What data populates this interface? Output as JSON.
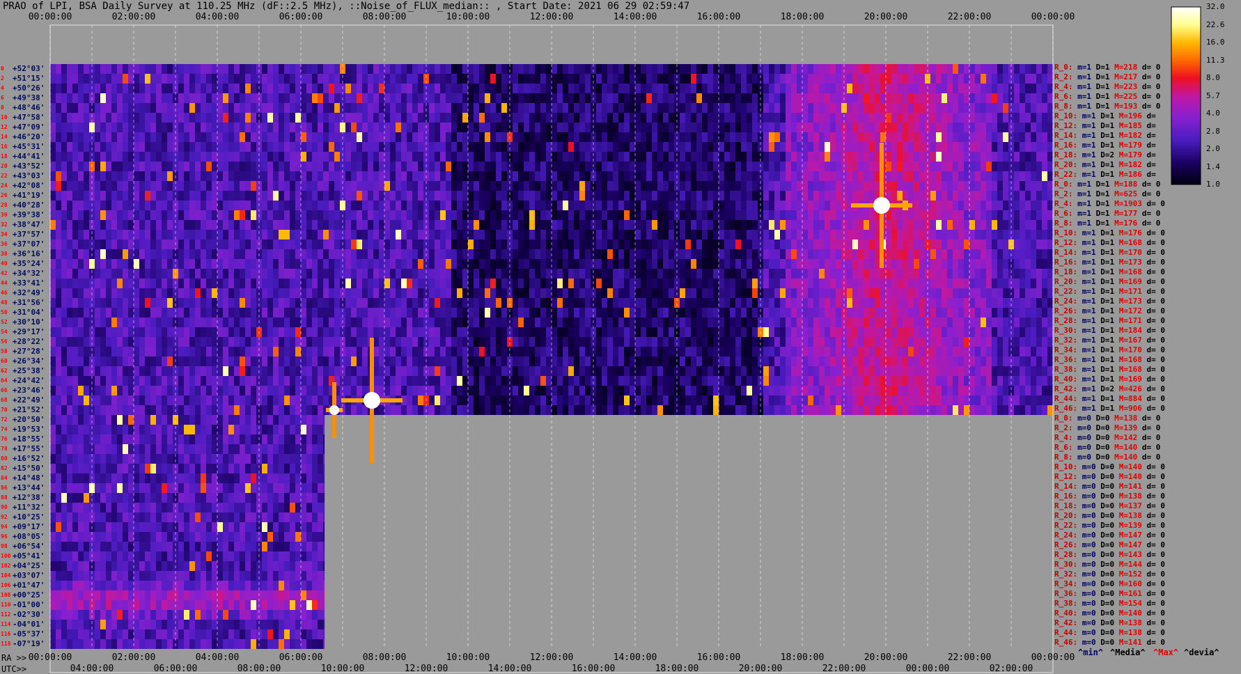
{
  "title": "PRAO of LPI, BSA Daily Survey at 110.25 MHz (dF::2.5 MHz), ::Noise_of_FLUX_median:: , Start Date: 2021 06 29 02:59:47",
  "chart_data": {
    "type": "heatmap",
    "top_axis_ticks": [
      "00:00:00",
      "02:00:00",
      "04:00:00",
      "06:00:00",
      "08:00:00",
      "10:00:00",
      "12:00:00",
      "14:00:00",
      "16:00:00",
      "18:00:00",
      "20:00:00",
      "22:00:00",
      "00:00:00"
    ],
    "ra_axis_label": "RA >>",
    "ra_axis_ticks": [
      "00:00:00",
      "02:00:00",
      "04:00:00",
      "06:00:00",
      "08:00:00",
      "10:00:00",
      "12:00:00",
      "14:00:00",
      "16:00:00",
      "18:00:00",
      "20:00:00",
      "22:00:00",
      "00:00:00"
    ],
    "utc_axis_label": "UTC>>",
    "utc_axis_ticks": [
      "04:00:00",
      "06:00:00",
      "08:00:00",
      "10:00:00",
      "12:00:00",
      "14:00:00",
      "16:00:00",
      "18:00:00",
      "20:00:00",
      "22:00:00",
      "00:00:00",
      "02:00:00"
    ],
    "row_numbers": [
      "0",
      "2",
      "4",
      "6",
      "8",
      "10",
      "12",
      "14",
      "16",
      "18",
      "20",
      "22",
      "24",
      "26",
      "28",
      "30",
      "32",
      "34",
      "36",
      "38",
      "40",
      "42",
      "44",
      "46",
      "48",
      "50",
      "52",
      "54",
      "56",
      "58",
      "60",
      "62",
      "64",
      "66",
      "68",
      "70",
      "72",
      "74",
      "76",
      "78",
      "80",
      "82",
      "84",
      "86",
      "88",
      "90",
      "92",
      "94",
      "96",
      "98",
      "100",
      "102",
      "104",
      "106",
      "108",
      "110",
      "112",
      "114",
      "116",
      "118"
    ],
    "declinations": [
      "+52°03'",
      "+51°15'",
      "+50°26'",
      "+49°38'",
      "+48°46'",
      "+47°58'",
      "+47°09'",
      "+46°20'",
      "+45°31'",
      "+44°41'",
      "+43°52'",
      "+43°03'",
      "+42°08'",
      "+41°19'",
      "+40°28'",
      "+39°38'",
      "+38°47'",
      "+37°57'",
      "+37°07'",
      "+36°16'",
      "+35°24'",
      "+34°32'",
      "+33°41'",
      "+32°49'",
      "+31°56'",
      "+31°04'",
      "+30°10'",
      "+29°17'",
      "+28°22'",
      "+27°28'",
      "+26°34'",
      "+25°38'",
      "+24°42'",
      "+23°46'",
      "+22°49'",
      "+21°52'",
      "+20°50'",
      "+19°53'",
      "+18°55'",
      "+17°55'",
      "+16°52'",
      "+15°50'",
      "+14°48'",
      "+13°44'",
      "+12°38'",
      "+11°32'",
      "+10°25'",
      "+09°17'",
      "+08°05'",
      "+06°54'",
      "+05°41'",
      "+04°25'",
      "+03°07'",
      "+01°47'",
      "+00°25'",
      "-01°00'",
      "-02°30'",
      "-04°01'",
      "-05°37'",
      "-07°19'"
    ],
    "colorbar": {
      "ticks": [
        "32.0",
        "22.6",
        "16.0",
        "11.3",
        "8.0",
        "5.7",
        "4.0",
        "2.8",
        "2.0",
        "1.4",
        "1.0"
      ],
      "scale": "log",
      "range": [
        1.0,
        32.0
      ],
      "colormap": [
        "#000010",
        "#1a0060",
        "#4a1cc0",
        "#8a20d0",
        "#c018a0",
        "#f01020",
        "#ff6a00",
        "#ffb800",
        "#ffff90",
        "#ffffff"
      ]
    },
    "row_stats": [
      {
        "R": "R_0:",
        "m": "m=1",
        "D": "D=1",
        "M": "M=218",
        "d": "d= 0"
      },
      {
        "R": "R_2:",
        "m": "m=1",
        "D": "D=1",
        "M": "M=217",
        "d": "d= 0"
      },
      {
        "R": "R_4:",
        "m": "m=1",
        "D": "D=1",
        "M": "M=223",
        "d": "d= 0"
      },
      {
        "R": "R_6:",
        "m": "m=1",
        "D": "D=1",
        "M": "M=225",
        "d": "d= 0"
      },
      {
        "R": "R_8:",
        "m": "m=1",
        "D": "D=1",
        "M": "M=193",
        "d": "d= 0"
      },
      {
        "R": "R_10:",
        "m": "m=1",
        "D": "D=1",
        "M": "M=196",
        "d": "d="
      },
      {
        "R": "R_12:",
        "m": "m=1",
        "D": "D=1",
        "M": "M=185",
        "d": "d="
      },
      {
        "R": "R_14:",
        "m": "m=1",
        "D": "D=1",
        "M": "M=182",
        "d": "d="
      },
      {
        "R": "R_16:",
        "m": "m=1",
        "D": "D=1",
        "M": "M=179",
        "d": "d="
      },
      {
        "R": "R_18:",
        "m": "m=1",
        "D": "D=2",
        "M": "M=179",
        "d": "d="
      },
      {
        "R": "R_20:",
        "m": "m=1",
        "D": "D=1",
        "M": "M=182",
        "d": "d="
      },
      {
        "R": "R_22:",
        "m": "m=1",
        "D": "D=1",
        "M": "M=186",
        "d": "d="
      },
      {
        "R": "R_0:",
        "m": "m=1",
        "D": "D=1",
        "M": "M=188",
        "d": "d= 0"
      },
      {
        "R": "R_2:",
        "m": "m=1",
        "D": "D=1",
        "M": "M=625",
        "d": "d= 0"
      },
      {
        "R": "R_4:",
        "m": "m=1",
        "D": "D=1",
        "M": "M=1903",
        "d": "d= 0"
      },
      {
        "R": "R_6:",
        "m": "m=1",
        "D": "D=1",
        "M": "M=177",
        "d": "d= 0"
      },
      {
        "R": "R_8:",
        "m": "m=1",
        "D": "D=1",
        "M": "M=176",
        "d": "d= 0"
      },
      {
        "R": "R_10:",
        "m": "m=1",
        "D": "D=1",
        "M": "M=176",
        "d": "d= 0"
      },
      {
        "R": "R_12:",
        "m": "m=1",
        "D": "D=1",
        "M": "M=168",
        "d": "d= 0"
      },
      {
        "R": "R_14:",
        "m": "m=1",
        "D": "D=1",
        "M": "M=170",
        "d": "d= 0"
      },
      {
        "R": "R_16:",
        "m": "m=1",
        "D": "D=1",
        "M": "M=173",
        "d": "d= 0"
      },
      {
        "R": "R_18:",
        "m": "m=1",
        "D": "D=1",
        "M": "M=168",
        "d": "d= 0"
      },
      {
        "R": "R_20:",
        "m": "m=1",
        "D": "D=1",
        "M": "M=169",
        "d": "d= 0"
      },
      {
        "R": "R_22:",
        "m": "m=1",
        "D": "D=1",
        "M": "M=171",
        "d": "d= 0"
      },
      {
        "R": "R_24:",
        "m": "m=1",
        "D": "D=1",
        "M": "M=173",
        "d": "d= 0"
      },
      {
        "R": "R_26:",
        "m": "m=1",
        "D": "D=1",
        "M": "M=172",
        "d": "d= 0"
      },
      {
        "R": "R_28:",
        "m": "m=1",
        "D": "D=1",
        "M": "M=171",
        "d": "d= 0"
      },
      {
        "R": "R_30:",
        "m": "m=1",
        "D": "D=1",
        "M": "M=184",
        "d": "d= 0"
      },
      {
        "R": "R_32:",
        "m": "m=1",
        "D": "D=1",
        "M": "M=167",
        "d": "d= 0"
      },
      {
        "R": "R_34:",
        "m": "m=1",
        "D": "D=1",
        "M": "M=170",
        "d": "d= 0"
      },
      {
        "R": "R_36:",
        "m": "m=1",
        "D": "D=1",
        "M": "M=168",
        "d": "d= 0"
      },
      {
        "R": "R_38:",
        "m": "m=1",
        "D": "D=1",
        "M": "M=168",
        "d": "d= 0"
      },
      {
        "R": "R_40:",
        "m": "m=1",
        "D": "D=1",
        "M": "M=169",
        "d": "d= 0"
      },
      {
        "R": "R_42:",
        "m": "m=1",
        "D": "D=2",
        "M": "M=426",
        "d": "d= 0"
      },
      {
        "R": "R_44:",
        "m": "m=1",
        "D": "D=1",
        "M": "M=884",
        "d": "d= 0"
      },
      {
        "R": "R_46:",
        "m": "m=1",
        "D": "D=1",
        "M": "M=906",
        "d": "d= 0"
      },
      {
        "R": "R_0:",
        "m": "m=0",
        "D": "D=0",
        "M": "M=138",
        "d": "d= 0"
      },
      {
        "R": "R_2:",
        "m": "m=0",
        "D": "D=0",
        "M": "M=139",
        "d": "d= 0"
      },
      {
        "R": "R_4:",
        "m": "m=0",
        "D": "D=0",
        "M": "M=142",
        "d": "d= 0"
      },
      {
        "R": "R_6:",
        "m": "m=0",
        "D": "D=0",
        "M": "M=140",
        "d": "d= 0"
      },
      {
        "R": "R_8:",
        "m": "m=0",
        "D": "D=0",
        "M": "M=140",
        "d": "d= 0"
      },
      {
        "R": "R_10:",
        "m": "m=0",
        "D": "D=0",
        "M": "M=140",
        "d": "d= 0"
      },
      {
        "R": "R_12:",
        "m": "m=0",
        "D": "D=0",
        "M": "M=140",
        "d": "d= 0"
      },
      {
        "R": "R_14:",
        "m": "m=0",
        "D": "D=0",
        "M": "M=141",
        "d": "d= 0"
      },
      {
        "R": "R_16:",
        "m": "m=0",
        "D": "D=0",
        "M": "M=138",
        "d": "d= 0"
      },
      {
        "R": "R_18:",
        "m": "m=0",
        "D": "D=0",
        "M": "M=137",
        "d": "d= 0"
      },
      {
        "R": "R_20:",
        "m": "m=0",
        "D": "D=0",
        "M": "M=138",
        "d": "d= 0"
      },
      {
        "R": "R_22:",
        "m": "m=0",
        "D": "D=0",
        "M": "M=139",
        "d": "d= 0"
      },
      {
        "R": "R_24:",
        "m": "m=0",
        "D": "D=0",
        "M": "M=147",
        "d": "d= 0"
      },
      {
        "R": "R_26:",
        "m": "m=0",
        "D": "D=0",
        "M": "M=147",
        "d": "d= 0"
      },
      {
        "R": "R_28:",
        "m": "m=0",
        "D": "D=0",
        "M": "M=143",
        "d": "d= 0"
      },
      {
        "R": "R_30:",
        "m": "m=0",
        "D": "D=0",
        "M": "M=144",
        "d": "d= 0"
      },
      {
        "R": "R_32:",
        "m": "m=0",
        "D": "D=0",
        "M": "M=152",
        "d": "d= 0"
      },
      {
        "R": "R_34:",
        "m": "m=0",
        "D": "D=0",
        "M": "M=160",
        "d": "d= 0"
      },
      {
        "R": "R_36:",
        "m": "m=0",
        "D": "D=0",
        "M": "M=161",
        "d": "d= 0"
      },
      {
        "R": "R_38:",
        "m": "m=0",
        "D": "D=0",
        "M": "M=154",
        "d": "d= 0"
      },
      {
        "R": "R_40:",
        "m": "m=0",
        "D": "D=0",
        "M": "M=140",
        "d": "d= 0"
      },
      {
        "R": "R_42:",
        "m": "m=0",
        "D": "D=0",
        "M": "M=138",
        "d": "d= 0"
      },
      {
        "R": "R_44:",
        "m": "m=0",
        "D": "D=0",
        "M": "M=138",
        "d": "d= 0"
      },
      {
        "R": "R_46:",
        "m": "m=0",
        "D": "D=0",
        "M": "M=141",
        "d": "d= 0"
      }
    ],
    "footer_labels": {
      "min": "^min^",
      "media": "^Media^",
      "max": "^Max^",
      "devia": "^devia^"
    },
    "sources": [
      {
        "ra_h": 7.7,
        "dec_row": 34,
        "intensity": 32
      },
      {
        "ra_h": 6.8,
        "dec_row": 35,
        "intensity": 26
      },
      {
        "ra_h": 19.9,
        "dec_row": 14,
        "intensity": 32
      }
    ]
  }
}
